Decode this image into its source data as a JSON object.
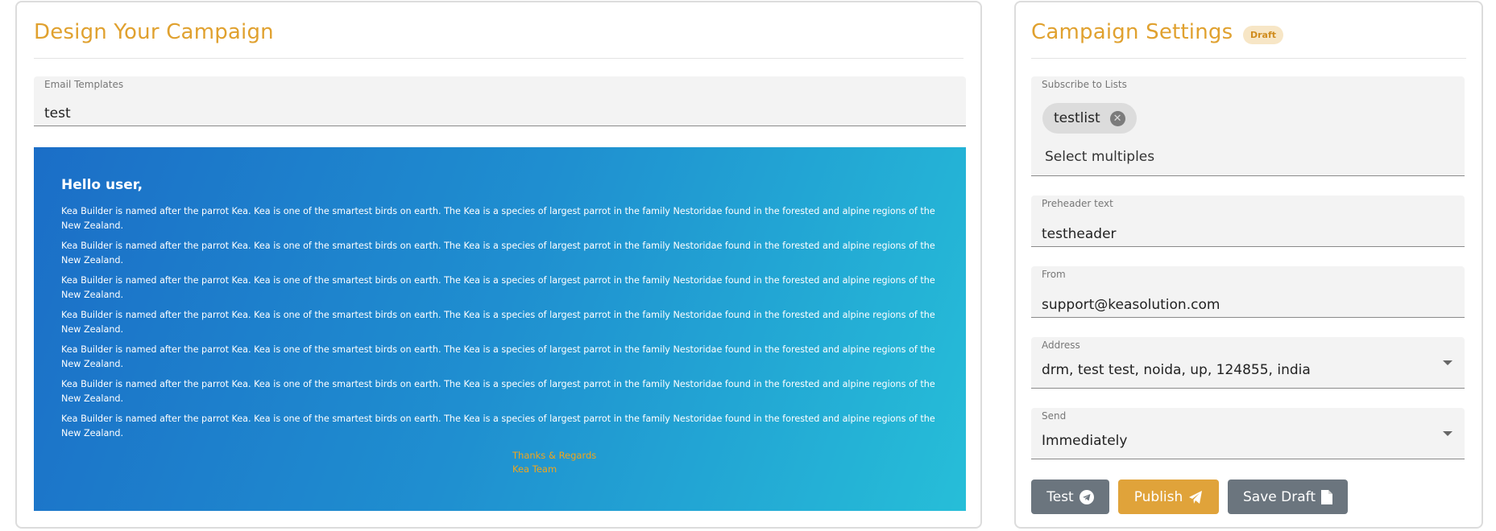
{
  "design": {
    "title": "Design Your Campaign",
    "template_field": {
      "label": "Email Templates",
      "value": "test"
    },
    "preview": {
      "greeting": "Hello user,",
      "paragraph_line1": "Kea Builder is named after the parrot Kea. Kea is one of the smartest birds on earth. The Kea is a species of largest parrot in the family Nestoridae found in the forested and alpine regions of the",
      "paragraph_line2": "New Zealand.",
      "paragraph_count": 7,
      "sign_line1": "Thanks & Regards",
      "sign_line2": "Kea Team"
    }
  },
  "settings": {
    "title": "Campaign Settings",
    "badge": "Draft",
    "lists_field": {
      "label": "Subscribe to Lists",
      "chips": [
        "testlist"
      ],
      "placeholder": "Select multiples"
    },
    "preheader_field": {
      "label": "Preheader text",
      "value": "testheader"
    },
    "from_field": {
      "label": "From",
      "value": "support@keasolution.com"
    },
    "address_field": {
      "label": "Address",
      "value": "drm, test test, noida, up, 124855, india"
    },
    "send_field": {
      "label": "Send",
      "value": "Immediately"
    },
    "buttons": {
      "test": "Test",
      "publish": "Publish",
      "save_draft": "Save Draft"
    }
  },
  "colors": {
    "accent": "#e0a12f",
    "preview_start": "#1b6ec7",
    "preview_end": "#26bed8",
    "button_gray": "#6b757e",
    "button_gold": "#e0a33a",
    "sign_text": "#f2a51b"
  },
  "icons": {
    "chip_remove": "close-circle-icon",
    "test": "telegram-icon",
    "publish": "paper-plane-icon",
    "save_draft": "file-icon",
    "dropdown": "caret-down-icon"
  }
}
